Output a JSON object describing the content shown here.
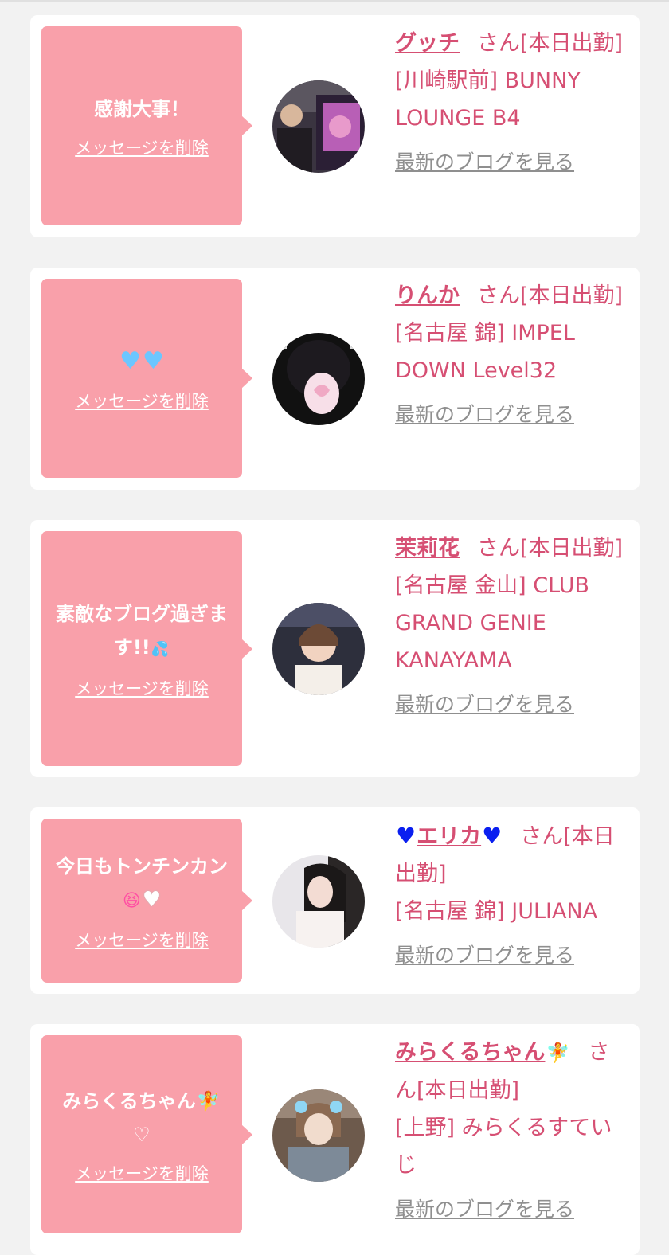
{
  "entries": [
    {
      "message": "感謝大事！",
      "delete_label": "メッセージを削除",
      "name": "グッチ",
      "suffix": "さん[本日出勤]",
      "location": "[川崎駅前] BUNNY LOUNGE B4",
      "blog_label": "最新のブログを見る"
    },
    {
      "message": "",
      "delete_label": "メッセージを削除",
      "name": "りんか",
      "suffix": "さん[本日出勤]",
      "location": "[名古屋 錦] IMPEL DOWN Level32",
      "blog_label": "最新のブログを見る"
    },
    {
      "message": "素敵なブログ過ぎます!!",
      "delete_label": "メッセージを削除",
      "name": "茉莉花",
      "suffix": "さん[本日出勤]",
      "location": "[名古屋 金山] CLUB GRAND GENIE KANAYAMA",
      "blog_label": "最新のブログを見る"
    },
    {
      "message": "今日もトンチンカン",
      "delete_label": "メッセージを削除",
      "name": "エリカ",
      "suffix": "さん[本日出勤]",
      "location": "[名古屋 錦] JULIANA",
      "blog_label": "最新のブログを見る"
    },
    {
      "message": "みらくるちゃん",
      "delete_label": "メッセージを削除",
      "name": "みらくるちゃん",
      "suffix": "さん[本日出勤]",
      "location": "[上野] みらくるすていじ",
      "blog_label": "最新のブログを見る"
    }
  ],
  "icons": {
    "blue_heart": "♥",
    "light_blue_heart": "♥",
    "white_heart": "♥",
    "white_heart_outline": "♡",
    "fairy": "🧚",
    "sweat_face": "💦",
    "grin_face": "😆"
  },
  "colors": {
    "bubble": "#f9a0aa",
    "name_text": "#d64f73",
    "link_gray": "#8f8f8f",
    "card_bg": "#ffffff",
    "page_bg": "#f2f2f2"
  }
}
